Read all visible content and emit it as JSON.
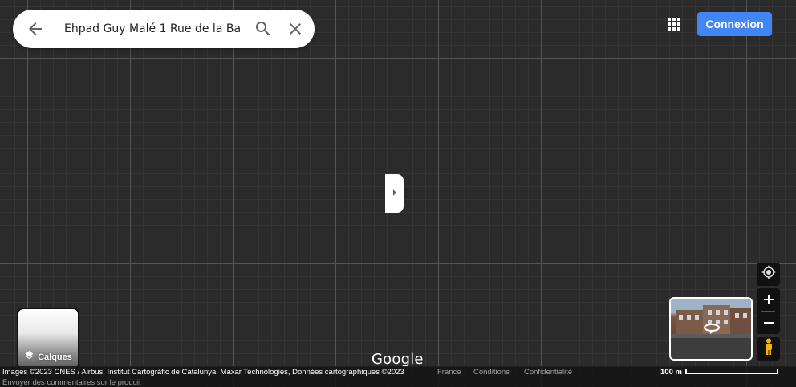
{
  "search": {
    "query": "Ehpad Guy Malé 1 Rue de la Ba",
    "back_icon": "arrow-left-icon",
    "search_icon": "search-icon",
    "clear_icon": "close-icon"
  },
  "header": {
    "apps_icon": "apps-grid-icon",
    "signin_label": "Connexion",
    "signin_color": "#4285f4"
  },
  "layers": {
    "label": "Calques",
    "icon": "layers-icon"
  },
  "controls": {
    "locate_icon": "my-location-icon",
    "zoom_in": "+",
    "zoom_out": "−",
    "pegman_icon": "pegman-icon",
    "pegman_color": "#f5b400"
  },
  "logo": "Google",
  "footer": {
    "attribution": "Images ©2023 CNES / Airbus, Institut Cartogràfic de Catalunya, Maxar Technologies, Données cartographiques ©2023",
    "links": [
      "France",
      "Conditions",
      "Confidentialité"
    ],
    "feedback": "Envoyer des commentaires sur le produit",
    "scale": "100 m"
  }
}
